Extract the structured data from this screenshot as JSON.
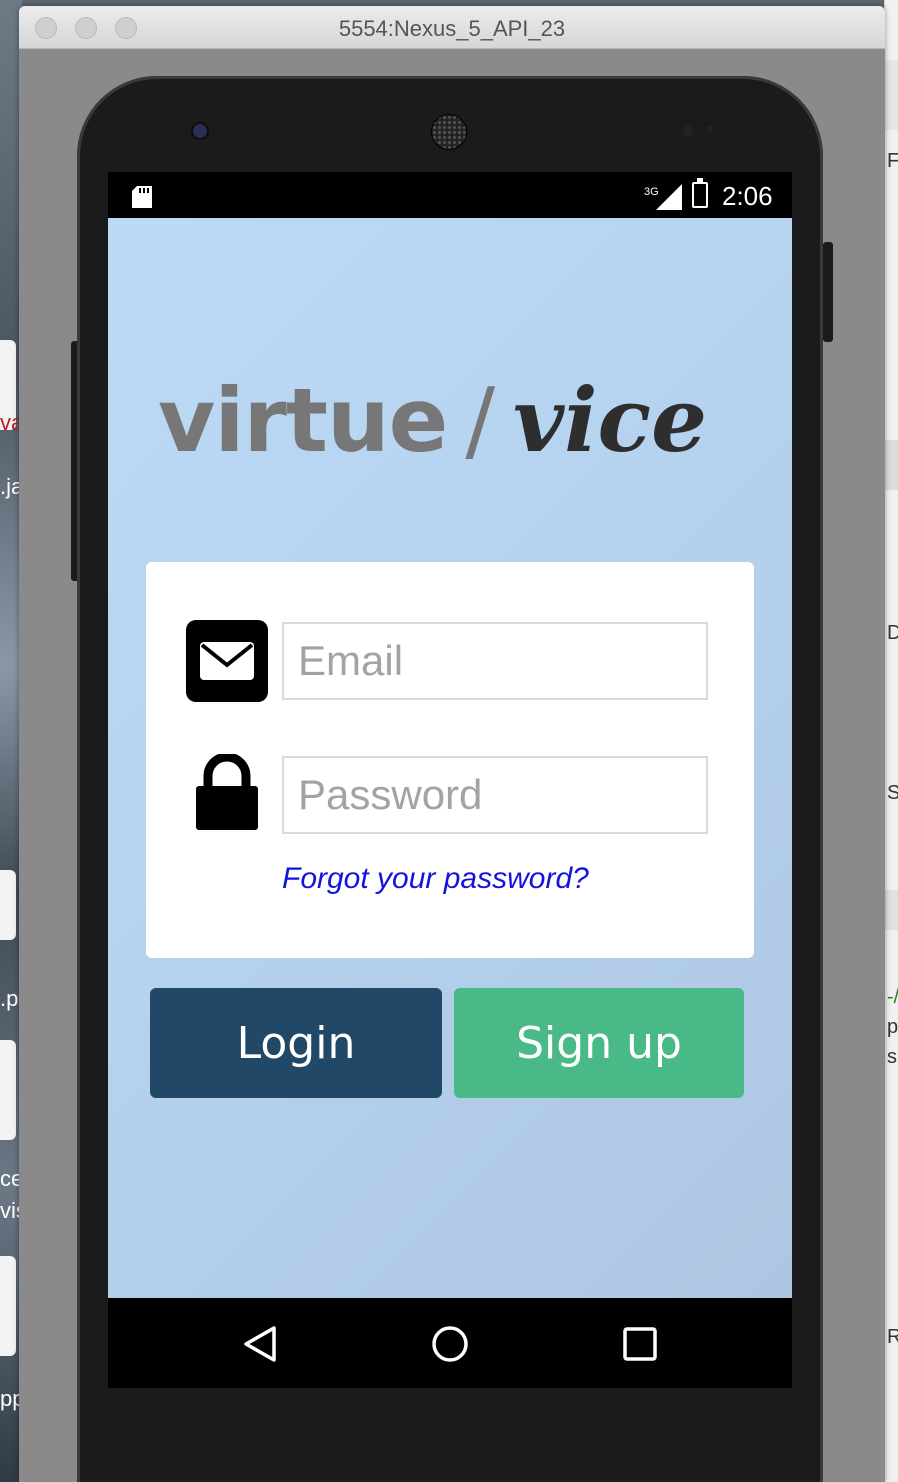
{
  "window": {
    "title": "5554:Nexus_5_API_23"
  },
  "status_bar": {
    "network": "3G",
    "time": "2:06"
  },
  "app": {
    "logo": {
      "virtue": "virtue",
      "slash": "/",
      "vice": "vice"
    },
    "email_placeholder": "Email",
    "password_placeholder": "Password",
    "forgot_link": "Forgot your password?",
    "login_label": "Login",
    "signup_label": "Sign up"
  },
  "desktop": {
    "left_fragments": [
      "va",
      ".ja",
      ".p",
      "ce",
      "vis",
      "pp"
    ],
    "right_fragments": [
      "F",
      "D",
      "S",
      "-/",
      "pe",
      "s ,",
      "Ru"
    ]
  },
  "colors": {
    "login_button": "#214866",
    "signup_button": "#48b987",
    "link": "#1313e0",
    "logo_virtue": "#777777",
    "logo_vice": "#2e2e2e"
  },
  "icons": {
    "email": "envelope-icon",
    "password": "lock-icon",
    "nav_back": "triangle-back-icon",
    "nav_home": "circle-home-icon",
    "nav_recents": "square-recents-icon"
  }
}
